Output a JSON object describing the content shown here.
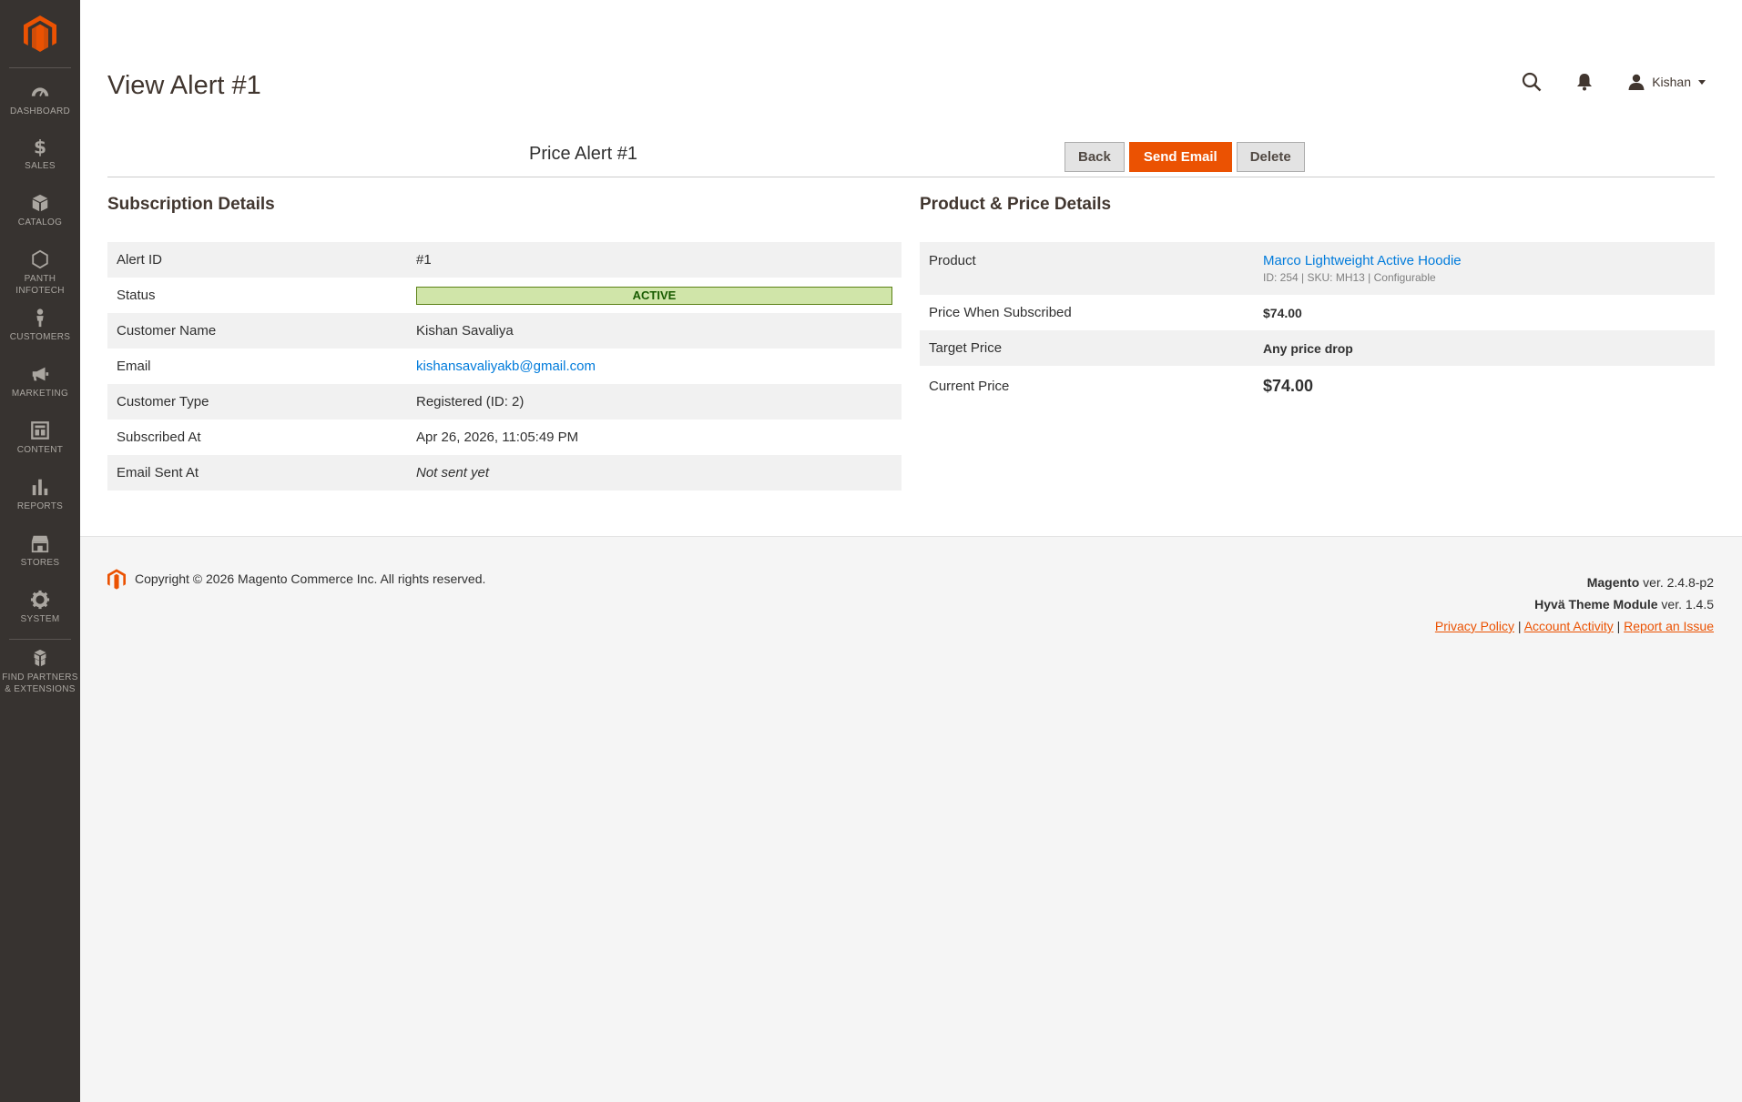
{
  "nav": {
    "items": [
      {
        "id": "dashboard",
        "label": "DASHBOARD",
        "icon": "dashboard-icon"
      },
      {
        "id": "sales",
        "label": "SALES",
        "icon": "dollar-icon"
      },
      {
        "id": "catalog",
        "label": "CATALOG",
        "icon": "box-icon"
      },
      {
        "id": "panth",
        "label": "PANTH INFOTECH",
        "icon": "hexagon-icon"
      },
      {
        "id": "customers",
        "label": "CUSTOMERS",
        "icon": "person-icon"
      },
      {
        "id": "marketing",
        "label": "MARKETING",
        "icon": "megaphone-icon"
      },
      {
        "id": "content",
        "label": "CONTENT",
        "icon": "layout-icon"
      },
      {
        "id": "reports",
        "label": "REPORTS",
        "icon": "bar-chart-icon"
      },
      {
        "id": "stores",
        "label": "STORES",
        "icon": "store-icon"
      },
      {
        "id": "system",
        "label": "SYSTEM",
        "icon": "gear-icon"
      },
      {
        "id": "partners",
        "label": "FIND PARTNERS & EXTENSIONS",
        "icon": "cubes-icon"
      }
    ]
  },
  "header": {
    "title": "View Alert #1",
    "user_name": "Kishan"
  },
  "form": {
    "heading": "Price Alert #1",
    "buttons": {
      "back": "Back",
      "send_email": "Send Email",
      "delete": "Delete"
    }
  },
  "subscription": {
    "title": "Subscription Details",
    "rows": {
      "alert_id": {
        "label": "Alert ID",
        "value": "#1"
      },
      "status": {
        "label": "Status",
        "value": "ACTIVE"
      },
      "customer_name": {
        "label": "Customer Name",
        "value": "Kishan Savaliya"
      },
      "email": {
        "label": "Email",
        "value": "kishansavaliyakb@gmail.com"
      },
      "customer_type": {
        "label": "Customer Type",
        "value": "Registered (ID: 2)"
      },
      "subscribed_at": {
        "label": "Subscribed At",
        "value": "Apr 26, 2026, 11:05:49 PM"
      },
      "email_sent_at": {
        "label": "Email Sent At",
        "value": "Not sent yet"
      }
    }
  },
  "product_details": {
    "title": "Product & Price Details",
    "rows": {
      "product": {
        "label": "Product",
        "value": "Marco Lightweight Active Hoodie",
        "meta": "ID: 254 | SKU: MH13 | Configurable"
      },
      "price_subscribed": {
        "label": "Price When Subscribed",
        "value": "$74.00"
      },
      "target_price": {
        "label": "Target Price",
        "value": "Any price drop"
      },
      "current_price": {
        "label": "Current Price",
        "value": "$74.00"
      }
    }
  },
  "footer": {
    "copyright": "Copyright © 2026 Magento Commerce Inc. All rights reserved.",
    "magento_name": "Magento",
    "magento_ver": " ver. 2.4.8-p2",
    "hyva_name": "Hyvä Theme Module",
    "hyva_ver": " ver. 1.4.5",
    "links": {
      "privacy": "Privacy Policy",
      "activity": " Account Activity",
      "report": "Report an Issue"
    },
    "separator": "|"
  },
  "colors": {
    "accent": "#eb5202",
    "sidebar": "#373330",
    "link": "#007bdb",
    "status_bg": "#d0e5a9"
  }
}
